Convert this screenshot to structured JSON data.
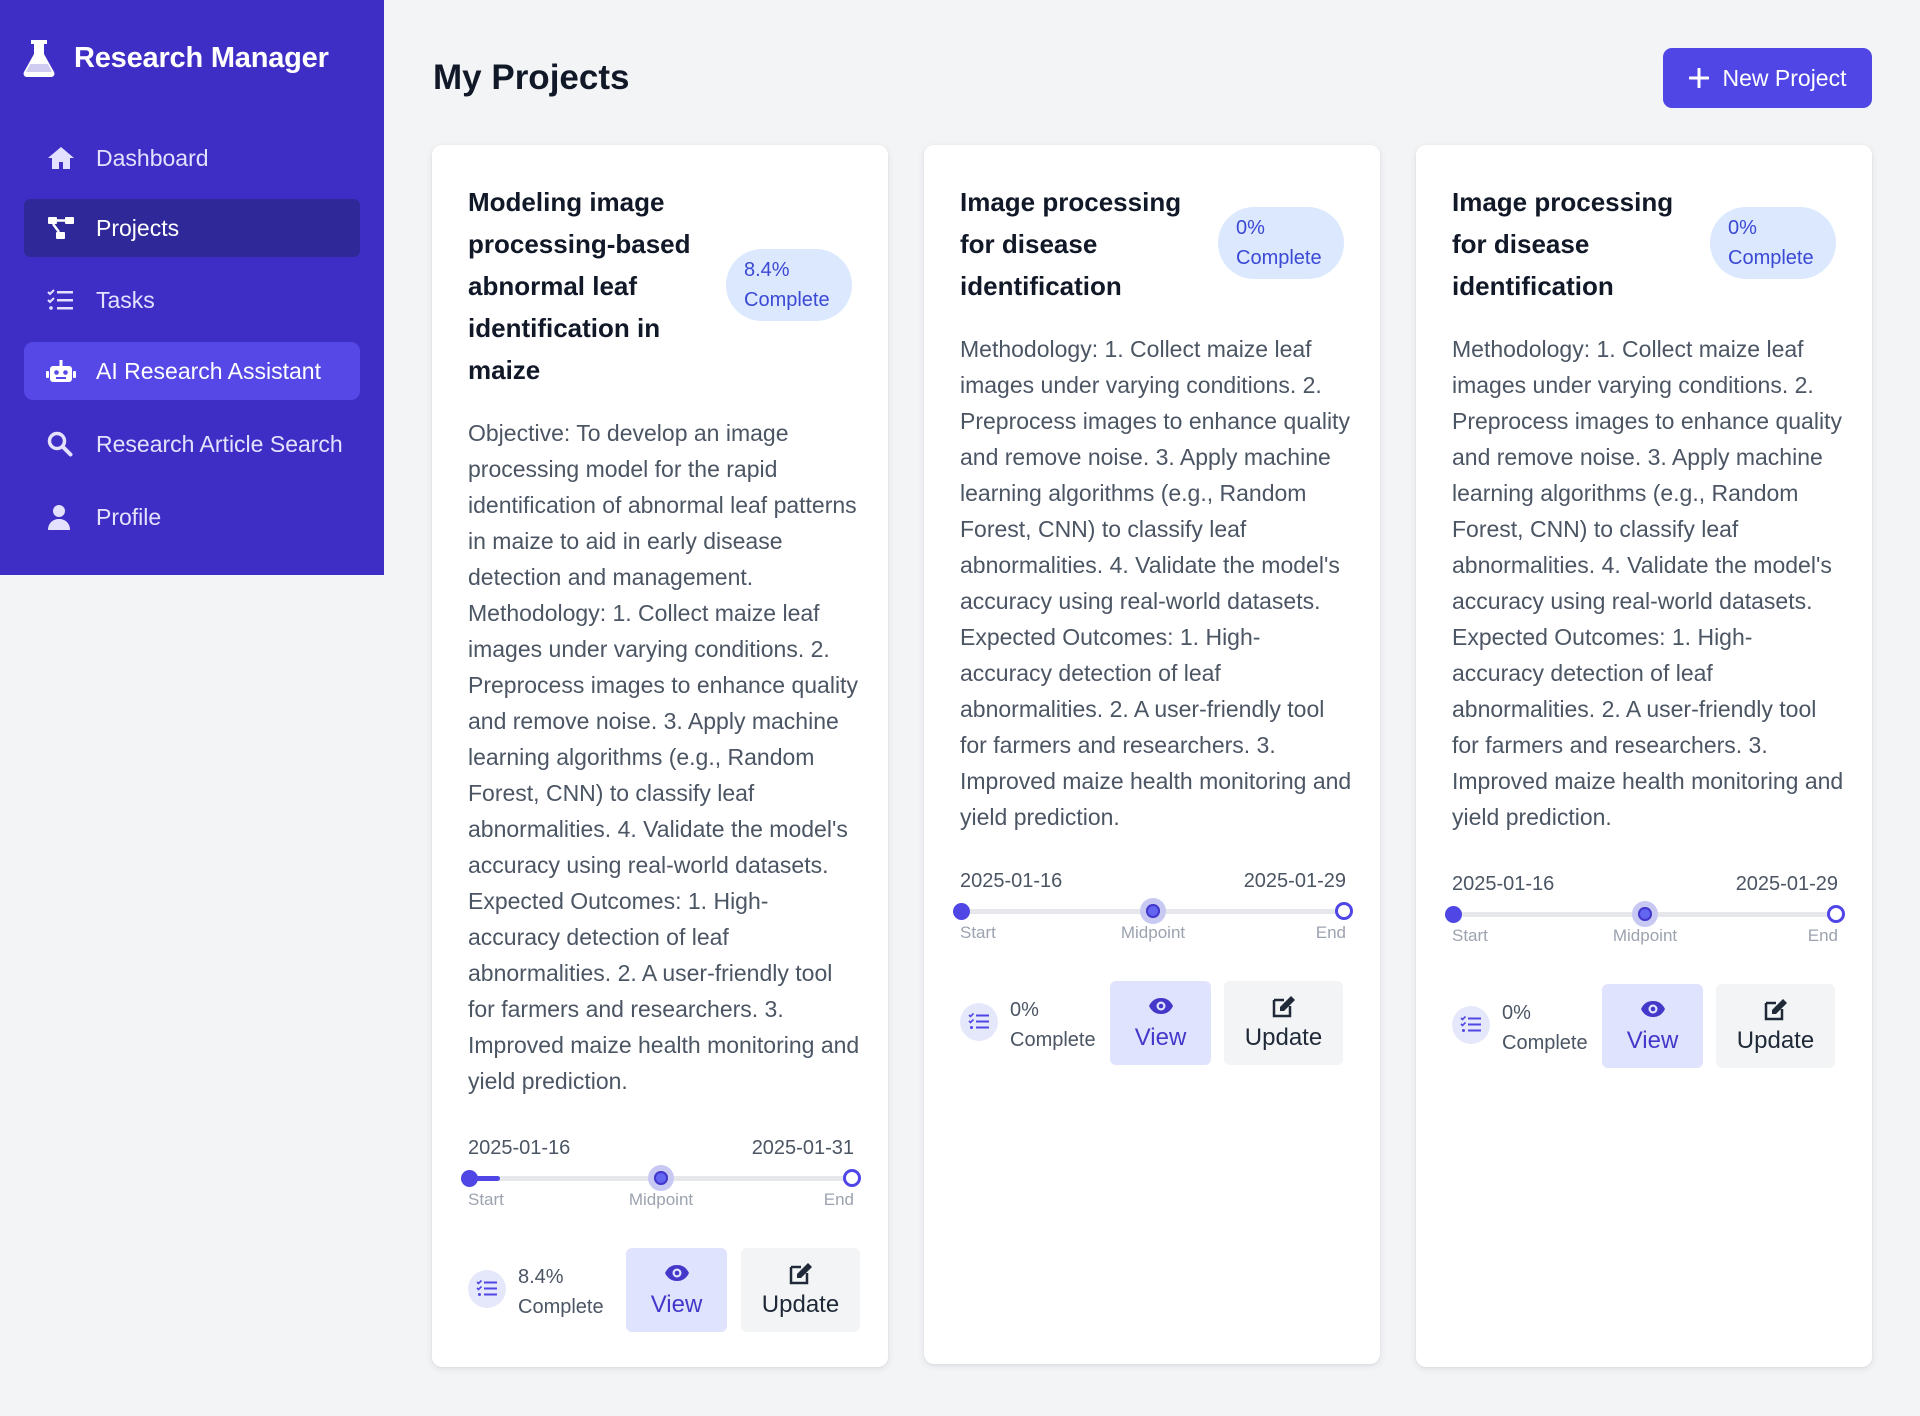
{
  "app": {
    "title": "Research Manager"
  },
  "sidebar": {
    "items": [
      {
        "label": "Dashboard",
        "icon": "home-icon"
      },
      {
        "label": "Projects",
        "icon": "project-diagram-icon",
        "state": "active"
      },
      {
        "label": "Tasks",
        "icon": "tasks-icon"
      },
      {
        "label": "AI Research Assistant",
        "icon": "robot-icon",
        "state": "highlighted"
      },
      {
        "label": "Research Article Search",
        "icon": "search-icon"
      },
      {
        "label": "Profile",
        "icon": "user-icon"
      }
    ]
  },
  "header": {
    "title": "My Projects",
    "new_project_label": "New Project"
  },
  "projects": [
    {
      "title": "Modeling image processing-based abnormal leaf identification in maize",
      "progress": 8.4,
      "badge_value": "8.4%",
      "badge_label": "Complete",
      "description": "Objective: To develop an image processing model for the rapid identification of abnormal leaf patterns in maize to aid in early disease detection and management. Methodology: 1. Collect maize leaf images under varying conditions. 2. Preprocess images to enhance quality and remove noise. 3. Apply machine learning algorithms (e.g., Random Forest, CNN) to classify leaf abnormalities. 4. Validate the model's accuracy using real-world datasets. Expected Outcomes: 1. High-accuracy detection of leaf abnormalities. 2. A user-friendly tool for farmers and researchers. 3. Improved maize health monitoring and yield prediction.",
      "start_date": "2025-01-16",
      "end_date": "2025-01-31",
      "timeline_labels": {
        "start": "Start",
        "mid": "Midpoint",
        "end": "End"
      },
      "footer_progress_value": "8.4%",
      "footer_progress_label": "Complete",
      "view_label": "View",
      "update_label": "Update"
    },
    {
      "title": "Image processing for disease identification",
      "progress": 0,
      "badge_value": "0%",
      "badge_label": "Complete",
      "description": "Methodology: 1. Collect maize leaf images under varying conditions. 2. Preprocess images to enhance quality and remove noise. 3. Apply machine learning algorithms (e.g., Random Forest, CNN) to classify leaf abnormalities. 4. Validate the model's accuracy using real-world datasets. Expected Outcomes: 1. High-accuracy detection of leaf abnormalities. 2. A user-friendly tool for farmers and researchers. 3. Improved maize health monitoring and yield prediction.",
      "start_date": "2025-01-16",
      "end_date": "2025-01-29",
      "timeline_labels": {
        "start": "Start",
        "mid": "Midpoint",
        "end": "End"
      },
      "footer_progress_value": "0%",
      "footer_progress_label": "Complete",
      "view_label": "View",
      "update_label": "Update"
    },
    {
      "title": "Image processing for disease identification",
      "progress": 0,
      "badge_value": "0%",
      "badge_label": "Complete",
      "description": "Methodology: 1. Collect maize leaf images under varying conditions. 2. Preprocess images to enhance quality and remove noise. 3. Apply machine learning algorithms (e.g., Random Forest, CNN) to classify leaf abnormalities. 4. Validate the model's accuracy using real-world datasets. Expected Outcomes: 1. High-accuracy detection of leaf abnormalities. 2. A user-friendly tool for farmers and researchers. 3. Improved maize health monitoring and yield prediction.",
      "start_date": "2025-01-16",
      "end_date": "2025-01-29",
      "timeline_labels": {
        "start": "Start",
        "mid": "Midpoint",
        "end": "End"
      },
      "footer_progress_value": "0%",
      "footer_progress_label": "Complete",
      "view_label": "View",
      "update_label": "Update"
    }
  ],
  "colors": {
    "sidebar_bg": "#3f2ec6",
    "sidebar_active": "#2f2898",
    "accent": "#4f46e5",
    "badge_bg": "#dbe8fe",
    "page_bg": "#f3f4f6"
  }
}
